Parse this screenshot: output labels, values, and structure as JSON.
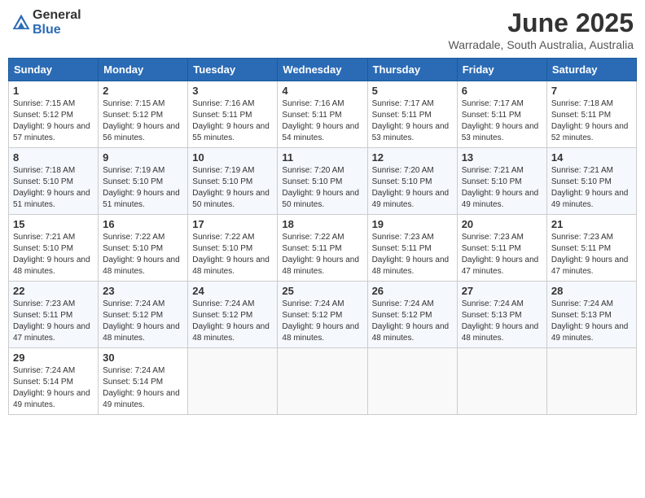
{
  "header": {
    "logo_line1": "General",
    "logo_line2": "Blue",
    "month": "June 2025",
    "location": "Warradale, South Australia, Australia"
  },
  "weekdays": [
    "Sunday",
    "Monday",
    "Tuesday",
    "Wednesday",
    "Thursday",
    "Friday",
    "Saturday"
  ],
  "weeks": [
    [
      {
        "day": 1,
        "rise": "7:15 AM",
        "set": "5:12 PM",
        "daylight": "9 hours and 57 minutes."
      },
      {
        "day": 2,
        "rise": "7:15 AM",
        "set": "5:12 PM",
        "daylight": "9 hours and 56 minutes."
      },
      {
        "day": 3,
        "rise": "7:16 AM",
        "set": "5:11 PM",
        "daylight": "9 hours and 55 minutes."
      },
      {
        "day": 4,
        "rise": "7:16 AM",
        "set": "5:11 PM",
        "daylight": "9 hours and 54 minutes."
      },
      {
        "day": 5,
        "rise": "7:17 AM",
        "set": "5:11 PM",
        "daylight": "9 hours and 53 minutes."
      },
      {
        "day": 6,
        "rise": "7:17 AM",
        "set": "5:11 PM",
        "daylight": "9 hours and 53 minutes."
      },
      {
        "day": 7,
        "rise": "7:18 AM",
        "set": "5:11 PM",
        "daylight": "9 hours and 52 minutes."
      }
    ],
    [
      {
        "day": 8,
        "rise": "7:18 AM",
        "set": "5:10 PM",
        "daylight": "9 hours and 51 minutes."
      },
      {
        "day": 9,
        "rise": "7:19 AM",
        "set": "5:10 PM",
        "daylight": "9 hours and 51 minutes."
      },
      {
        "day": 10,
        "rise": "7:19 AM",
        "set": "5:10 PM",
        "daylight": "9 hours and 50 minutes."
      },
      {
        "day": 11,
        "rise": "7:20 AM",
        "set": "5:10 PM",
        "daylight": "9 hours and 50 minutes."
      },
      {
        "day": 12,
        "rise": "7:20 AM",
        "set": "5:10 PM",
        "daylight": "9 hours and 49 minutes."
      },
      {
        "day": 13,
        "rise": "7:21 AM",
        "set": "5:10 PM",
        "daylight": "9 hours and 49 minutes."
      },
      {
        "day": 14,
        "rise": "7:21 AM",
        "set": "5:10 PM",
        "daylight": "9 hours and 49 minutes."
      }
    ],
    [
      {
        "day": 15,
        "rise": "7:21 AM",
        "set": "5:10 PM",
        "daylight": "9 hours and 48 minutes."
      },
      {
        "day": 16,
        "rise": "7:22 AM",
        "set": "5:10 PM",
        "daylight": "9 hours and 48 minutes."
      },
      {
        "day": 17,
        "rise": "7:22 AM",
        "set": "5:10 PM",
        "daylight": "9 hours and 48 minutes."
      },
      {
        "day": 18,
        "rise": "7:22 AM",
        "set": "5:11 PM",
        "daylight": "9 hours and 48 minutes."
      },
      {
        "day": 19,
        "rise": "7:23 AM",
        "set": "5:11 PM",
        "daylight": "9 hours and 48 minutes."
      },
      {
        "day": 20,
        "rise": "7:23 AM",
        "set": "5:11 PM",
        "daylight": "9 hours and 47 minutes."
      },
      {
        "day": 21,
        "rise": "7:23 AM",
        "set": "5:11 PM",
        "daylight": "9 hours and 47 minutes."
      }
    ],
    [
      {
        "day": 22,
        "rise": "7:23 AM",
        "set": "5:11 PM",
        "daylight": "9 hours and 47 minutes."
      },
      {
        "day": 23,
        "rise": "7:24 AM",
        "set": "5:12 PM",
        "daylight": "9 hours and 48 minutes."
      },
      {
        "day": 24,
        "rise": "7:24 AM",
        "set": "5:12 PM",
        "daylight": "9 hours and 48 minutes."
      },
      {
        "day": 25,
        "rise": "7:24 AM",
        "set": "5:12 PM",
        "daylight": "9 hours and 48 minutes."
      },
      {
        "day": 26,
        "rise": "7:24 AM",
        "set": "5:12 PM",
        "daylight": "9 hours and 48 minutes."
      },
      {
        "day": 27,
        "rise": "7:24 AM",
        "set": "5:13 PM",
        "daylight": "9 hours and 48 minutes."
      },
      {
        "day": 28,
        "rise": "7:24 AM",
        "set": "5:13 PM",
        "daylight": "9 hours and 49 minutes."
      }
    ],
    [
      {
        "day": 29,
        "rise": "7:24 AM",
        "set": "5:14 PM",
        "daylight": "9 hours and 49 minutes."
      },
      {
        "day": 30,
        "rise": "7:24 AM",
        "set": "5:14 PM",
        "daylight": "9 hours and 49 minutes."
      },
      null,
      null,
      null,
      null,
      null
    ]
  ]
}
